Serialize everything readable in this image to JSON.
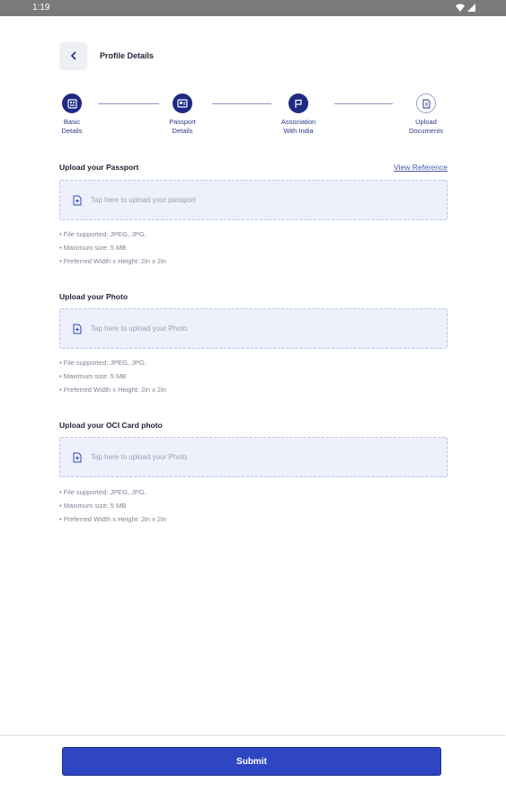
{
  "status_bar": {
    "time": "1:19"
  },
  "header": {
    "title": "Profile Details"
  },
  "stepper": {
    "steps": [
      {
        "label_line1": "Basic",
        "label_line2": "Details",
        "state": "complete",
        "icon": "id-card-icon"
      },
      {
        "label_line1": "Passport",
        "label_line2": "Details",
        "state": "complete",
        "icon": "passport-icon"
      },
      {
        "label_line1": "Association",
        "label_line2": "With India",
        "state": "complete",
        "icon": "flag-icon"
      },
      {
        "label_line1": "Upload",
        "label_line2": "Documents",
        "state": "current",
        "icon": "document-icon"
      }
    ]
  },
  "sections": [
    {
      "title": "Upload your Passport",
      "link": "View Reference",
      "upload_text": "Tap here to upload your passport",
      "bullets": [
        "• File supported: JPEG,  JPG.",
        "• Maximum size: 5 MB",
        "• Preferred Width x Height: 2in x 2in"
      ]
    },
    {
      "title": "Upload your Photo",
      "upload_text": "Tap here to upload your Photo",
      "bullets": [
        "• File supported: JPEG,  JPG.",
        "• Maximum size: 5 MB",
        "• Preferred Width x Height: 2in x 2in"
      ]
    },
    {
      "title": "Upload your OCI Card photo",
      "upload_text": "Tap here to upload your Photo",
      "bullets": [
        "• File supported: JPEG,  JPG.",
        "• Maximum size: 5 MB",
        "• Preferred Width x Height: 2in x 2in"
      ]
    }
  ],
  "footer": {
    "submit_label": "Submit"
  },
  "colors": {
    "primary": "#1f2a83",
    "accent": "#2e46c2",
    "upload_bg": "#eef1fb"
  }
}
